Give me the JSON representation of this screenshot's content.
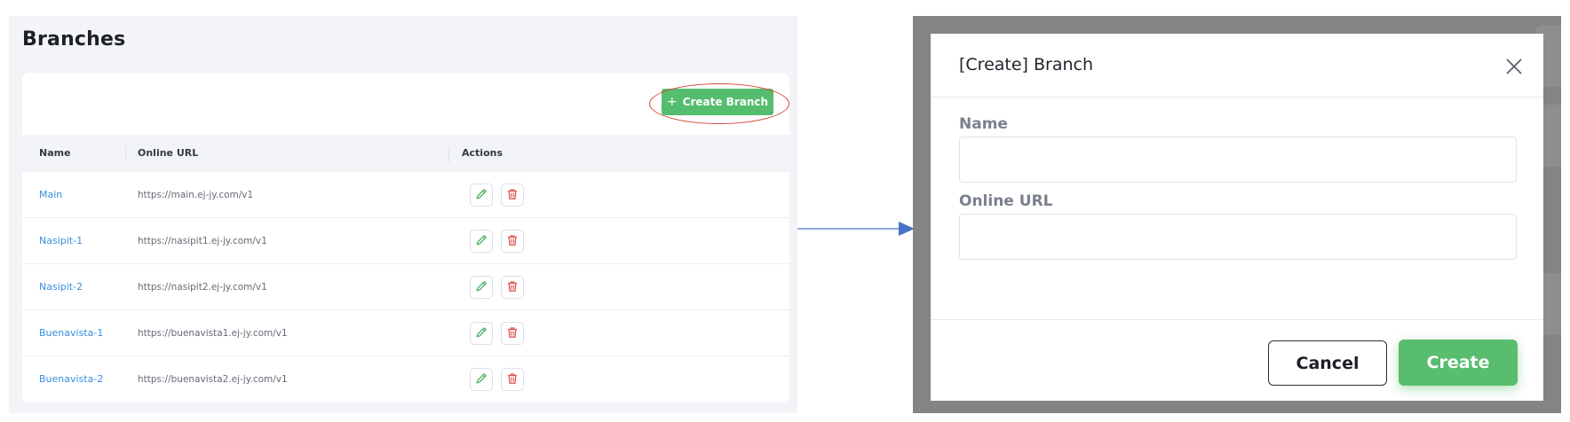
{
  "branches_page": {
    "title": "Branches",
    "create_button_label": "Create Branch",
    "table": {
      "columns": [
        "Name",
        "Online URL",
        "Actions"
      ],
      "rows": [
        {
          "name": "Main",
          "url": "https://main.ej-jy.com/v1"
        },
        {
          "name": "Nasipit-1",
          "url": "https://nasipit1.ej-jy.com/v1"
        },
        {
          "name": "Nasipit-2",
          "url": "https://nasipit2.ej-jy.com/v1"
        },
        {
          "name": "Buenavista-1",
          "url": "https://buenavista1.ej-jy.com/v1"
        },
        {
          "name": "Buenavista-2",
          "url": "https://buenavista2.ej-jy.com/v1"
        }
      ]
    },
    "row_actions": [
      {
        "icon": "pencil-icon",
        "color": "#4caf62"
      },
      {
        "icon": "trash-icon",
        "color": "#e05252"
      }
    ]
  },
  "modal": {
    "title": "[Create] Branch",
    "fields": [
      {
        "label": "Name",
        "value": "",
        "placeholder": ""
      },
      {
        "label": "Online URL",
        "value": "",
        "placeholder": ""
      }
    ],
    "cancel_label": "Cancel",
    "create_label": "Create"
  },
  "colors": {
    "accent_green": "#55bd6e",
    "link_blue": "#3a8ee0",
    "highlight_red": "#d64533",
    "arrow_blue": "#4a72c4",
    "overlay_gray": "#848484"
  }
}
